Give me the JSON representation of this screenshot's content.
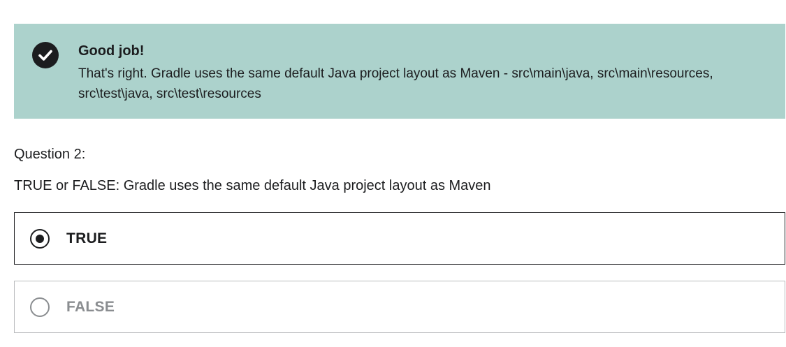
{
  "feedback": {
    "icon": "check-circle-icon",
    "title": "Good job!",
    "message": "That's right. Gradle uses the same default Java project layout as Maven - src\\main\\java, src\\main\\resources, src\\test\\java, src\\test\\resources",
    "background_color": "#acd2cc"
  },
  "question": {
    "label": "Question 2:",
    "text": "TRUE or FALSE: Gradle uses the same default Java project layout as Maven"
  },
  "options": [
    {
      "label": "TRUE",
      "selected": true
    },
    {
      "label": "FALSE",
      "selected": false
    }
  ]
}
